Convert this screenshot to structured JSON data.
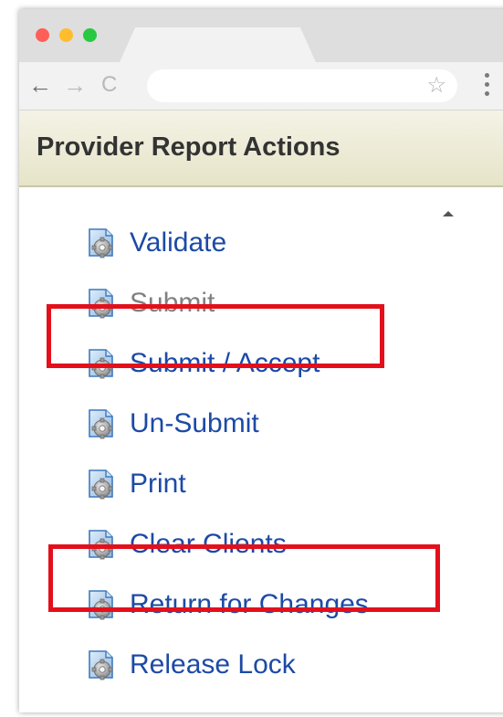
{
  "browser": {
    "back_glyph": "←",
    "forward_glyph": "→",
    "reload_glyph": "C",
    "bookmark_glyph": "☆",
    "icons": [
      "back-arrow-icon",
      "forward-arrow-icon",
      "reload-icon",
      "bookmark-star-icon",
      "menu-kebab-icon"
    ],
    "traffic_light_colors": [
      "#ff5f57",
      "#ffbd2e",
      "#28c840"
    ]
  },
  "panel": {
    "title": "Provider Report Actions",
    "collapse_icon": "collapse-up-icon",
    "actions": [
      {
        "label": "Validate",
        "enabled": true,
        "icon": "report-gear-icon"
      },
      {
        "label": "Submit",
        "enabled": false,
        "icon": "report-gear-icon"
      },
      {
        "label": "Submit / Accept",
        "enabled": true,
        "icon": "report-gear-icon",
        "highlighted": true
      },
      {
        "label": "Un-Submit",
        "enabled": true,
        "icon": "report-gear-icon"
      },
      {
        "label": "Print",
        "enabled": true,
        "icon": "report-gear-icon"
      },
      {
        "label": "Clear Clients",
        "enabled": true,
        "icon": "report-gear-icon"
      },
      {
        "label": "Return for Changes",
        "enabled": true,
        "icon": "report-gear-icon",
        "highlighted": true
      },
      {
        "label": "Release Lock",
        "enabled": true,
        "icon": "report-gear-icon"
      }
    ]
  },
  "colors": {
    "link": "#1c4aa6",
    "disabled": "#808080",
    "highlight_box": "#e3101c",
    "header_bg": "#e6e4c8"
  }
}
